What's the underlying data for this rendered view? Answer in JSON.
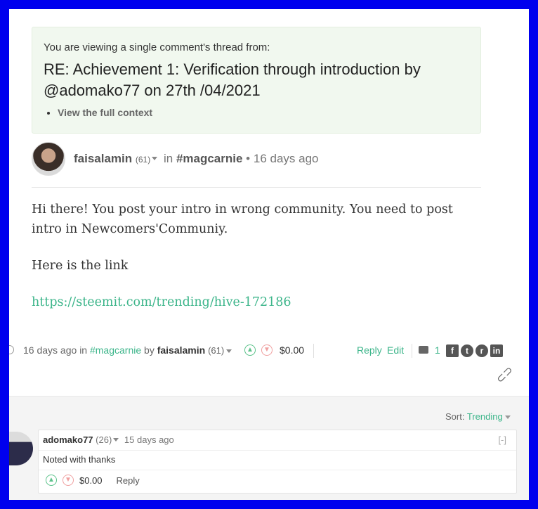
{
  "context": {
    "intro": "You are viewing a single comment's thread from:",
    "title": "RE: Achievement 1: Verification through introduction by @adomako77 on 27th /04/2021",
    "link": "View the full context"
  },
  "post": {
    "author": "faisalamin",
    "reputation": "(61)",
    "in_label": "in",
    "tag": "#magcarnie",
    "age": "16 days ago",
    "body": [
      "Hi there! You post your intro in wrong community. You need to post intro in Newcomers'Communiy.",
      "Here is the link"
    ],
    "url": "https://steemit.com/trending/hive-172186"
  },
  "footer": {
    "age": "16 days ago",
    "in_label": "in",
    "tag": "#magcarnie",
    "by_label": "by",
    "author": "faisalamin",
    "reputation": "(61)",
    "payout": "$0.00",
    "reply": "Reply",
    "edit": "Edit",
    "comment_count": "1"
  },
  "sort": {
    "label": "Sort:",
    "value": "Trending"
  },
  "comment": {
    "author": "adomako77",
    "reputation": "(26)",
    "age": "15 days ago",
    "collapse": "[-]",
    "text": "Noted with thanks",
    "payout": "$0.00",
    "reply": "Reply"
  },
  "icons": [
    "clock-icon",
    "upvote-icon",
    "downvote-icon",
    "comments-icon",
    "facebook-icon",
    "twitter-icon",
    "reddit-icon",
    "linkedin-icon",
    "link-icon"
  ],
  "colors": {
    "frame_border": "#0000ee",
    "accent_green": "#3cb58a",
    "context_bg": "#f1f8ef"
  }
}
